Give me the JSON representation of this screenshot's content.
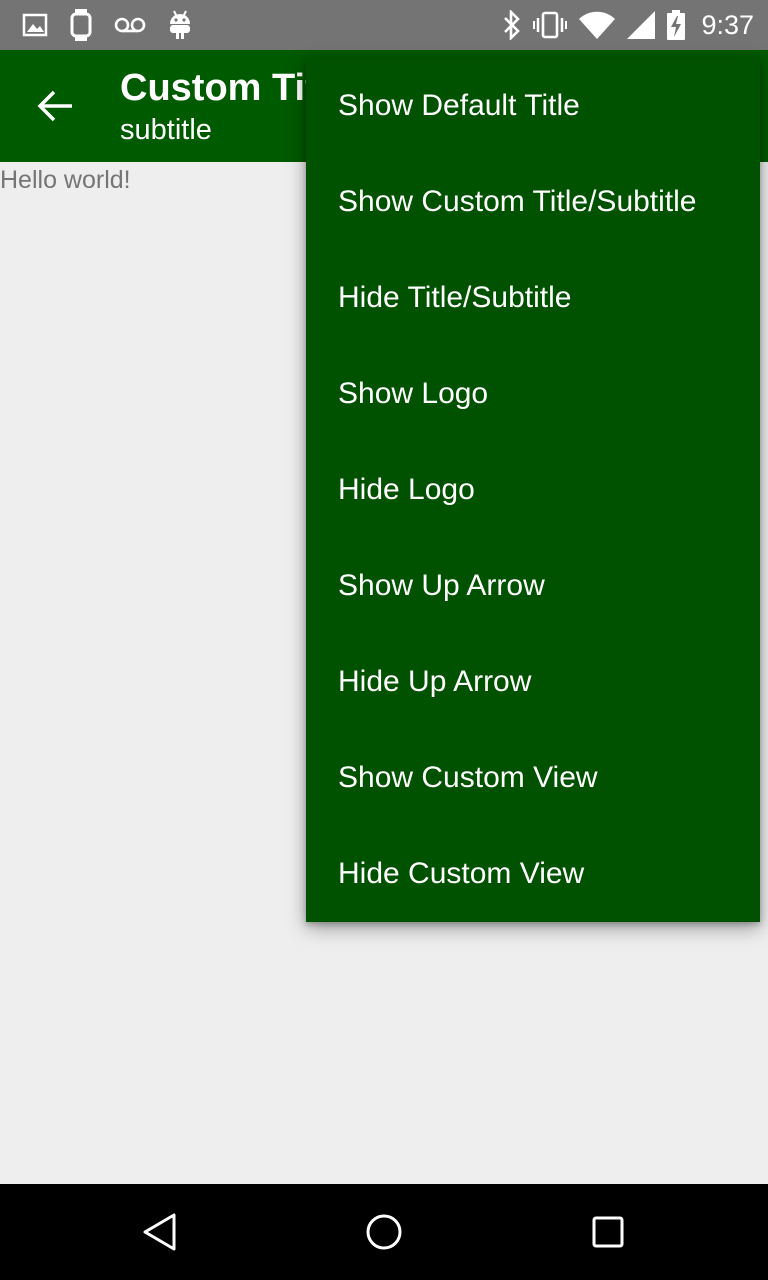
{
  "status_bar": {
    "time": "9:37",
    "left_icons": [
      "image-icon",
      "watch-icon",
      "voicemail-icon",
      "android-icon"
    ],
    "right_icons": [
      "bluetooth-icon",
      "vibrate-icon",
      "wifi-icon",
      "signal-icon",
      "battery-charging-icon"
    ]
  },
  "toolbar": {
    "title": "Custom Title",
    "subtitle": "subtitle",
    "up_icon": "arrow-back-icon"
  },
  "content": {
    "text": "Hello world!"
  },
  "menu": {
    "items": [
      {
        "label": "Show Default Title"
      },
      {
        "label": "Show Custom Title/Subtitle"
      },
      {
        "label": "Hide Title/Subtitle"
      },
      {
        "label": "Show Logo"
      },
      {
        "label": "Hide Logo"
      },
      {
        "label": "Show Up Arrow"
      },
      {
        "label": "Hide Up Arrow"
      },
      {
        "label": "Show Custom View"
      },
      {
        "label": "Hide Custom View"
      }
    ]
  },
  "navigation_bar": {
    "icons": [
      "back-triangle-icon",
      "home-circle-icon",
      "recents-square-icon"
    ]
  },
  "colors": {
    "status_bar": "#747474",
    "toolbar": "#005a00",
    "menu": "#005200",
    "background": "#eeeeee",
    "content_text": "#757575"
  }
}
